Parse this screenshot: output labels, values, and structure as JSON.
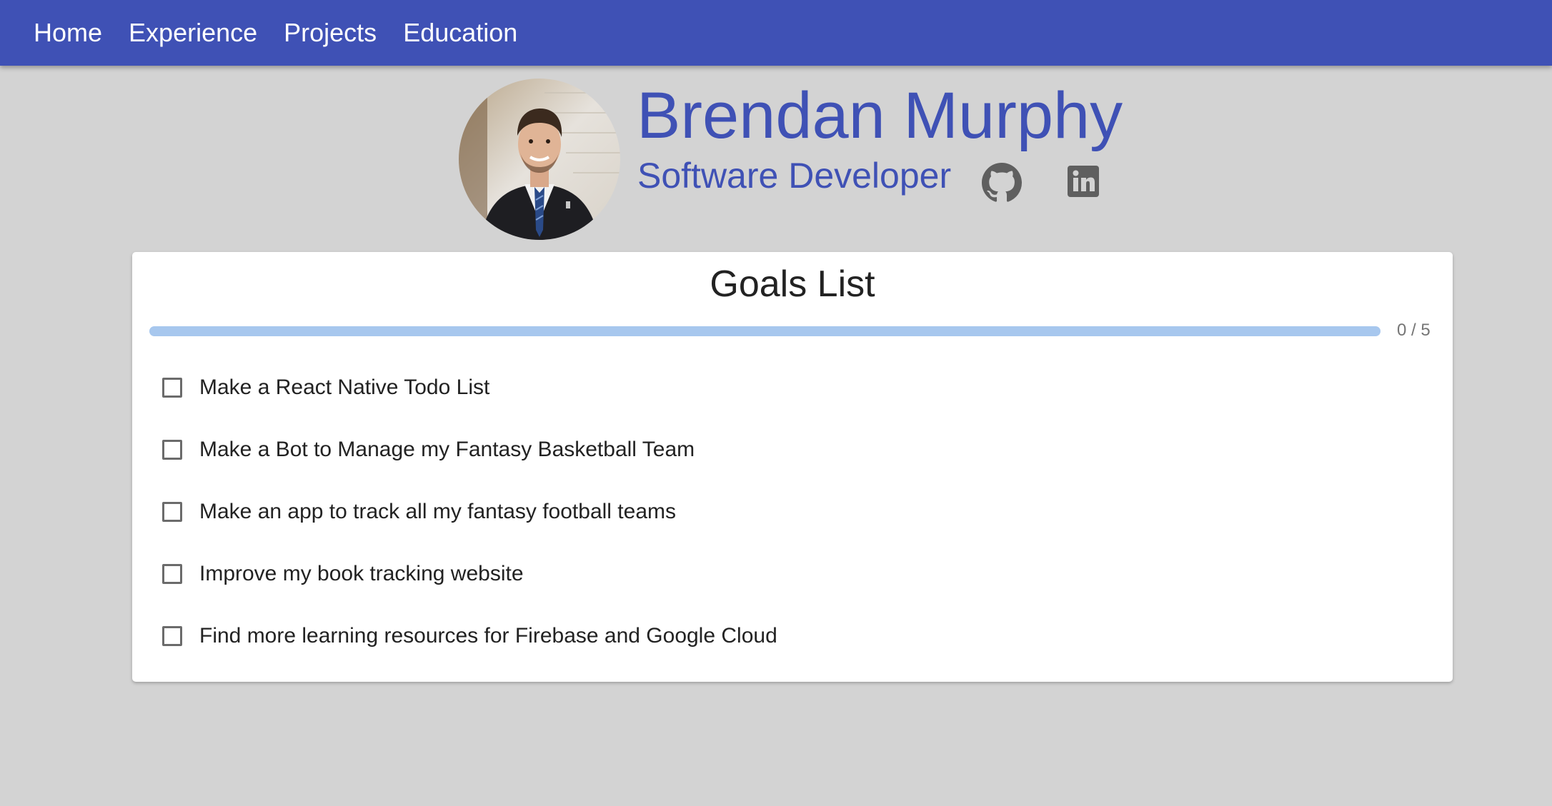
{
  "nav": {
    "items": [
      {
        "label": "Home"
      },
      {
        "label": "Experience"
      },
      {
        "label": "Projects"
      },
      {
        "label": "Education"
      }
    ]
  },
  "profile": {
    "name": "Brendan Murphy",
    "role": "Software Developer",
    "links": [
      {
        "icon": "github-icon"
      },
      {
        "icon": "linkedin-icon"
      }
    ]
  },
  "goals": {
    "title": "Goals List",
    "progress_label": "0 / 5",
    "progress_fraction": 0,
    "items": [
      {
        "label": "Make a React Native Todo List",
        "checked": false
      },
      {
        "label": "Make a Bot to Manage my Fantasy Basketball Team",
        "checked": false
      },
      {
        "label": "Make an app to track all my fantasy football teams",
        "checked": false
      },
      {
        "label": "Improve my book tracking website",
        "checked": false
      },
      {
        "label": "Find more learning resources for Firebase and Google Cloud",
        "checked": false
      }
    ]
  },
  "colors": {
    "primary": "#3f51b5",
    "progress_track": "#a7c7ee",
    "background": "#d3d3d3"
  }
}
